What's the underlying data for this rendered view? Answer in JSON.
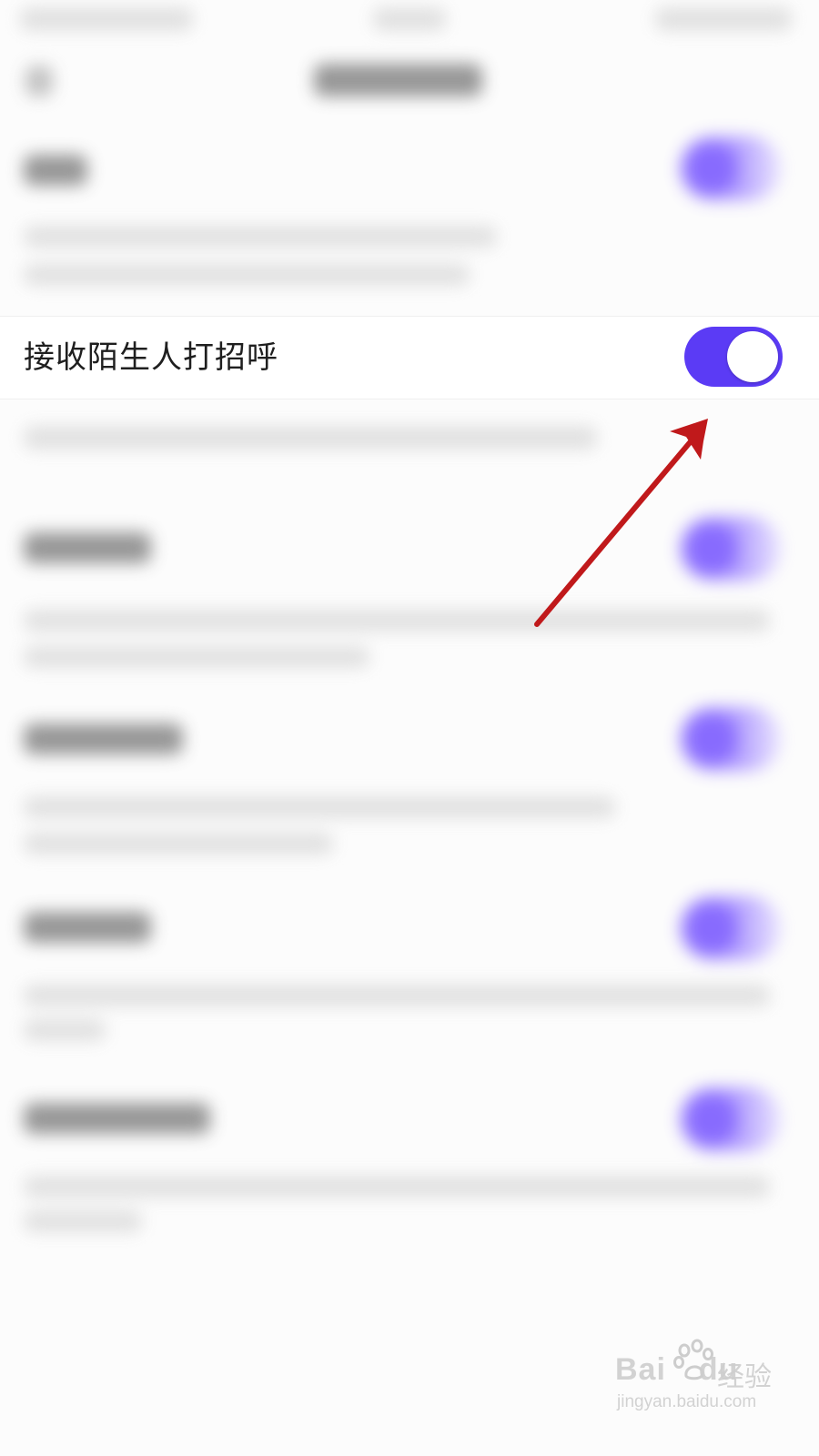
{
  "settings": {
    "focused_item": {
      "label": "接收陌生人打招呼",
      "toggle_on": true
    }
  },
  "colors": {
    "toggle_on": "#5b3bf5",
    "toggle_thumb": "#ffffff",
    "annotation_arrow": "#c0191b",
    "background": "#fcfcfc"
  },
  "icons": {
    "annotation": "arrow-pointer-icon",
    "watermark": "baidu-paw-icon"
  },
  "watermark": {
    "brand": "Bai",
    "brand_suffix": "du",
    "product": "经验",
    "url": "jingyan.baidu.com"
  }
}
